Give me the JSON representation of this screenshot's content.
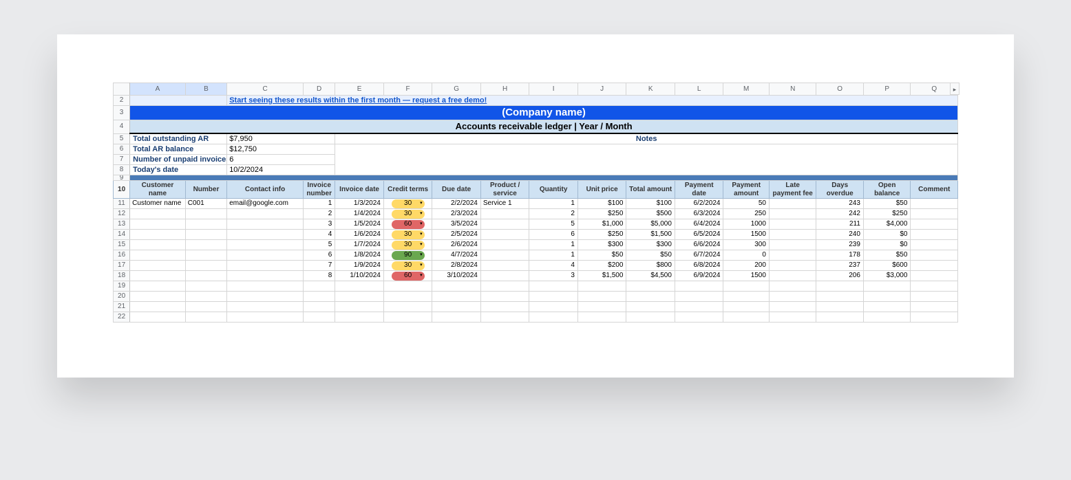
{
  "columns": [
    "A",
    "B",
    "C",
    "D",
    "E",
    "F",
    "G",
    "H",
    "I",
    "J",
    "K",
    "L",
    "M",
    "N",
    "O",
    "P",
    "Q"
  ],
  "selected_columns": [
    "A",
    "B"
  ],
  "row_numbers": [
    "2",
    "3",
    "4",
    "5",
    "6",
    "7",
    "8",
    "9",
    "10",
    "11",
    "12",
    "13",
    "14",
    "15",
    "16",
    "17",
    "18",
    "19",
    "20",
    "21",
    "22"
  ],
  "link_text": "Start seeing these results within the first month — request a free demo!",
  "company_name": "(Company name)",
  "ledger_title": "Accounts receivable ledger | Year / Month",
  "summary": {
    "total_outstanding_ar_label": "Total outstanding AR",
    "total_outstanding_ar_value": "$7,950",
    "total_ar_balance_label": "Total AR balance",
    "total_ar_balance_value": "$12,750",
    "unpaid_invoices_label": "Number of unpaid invoices",
    "unpaid_invoices_value": "6",
    "todays_date_label": "Today's date",
    "todays_date_value": "10/2/2024",
    "notes_label": "Notes"
  },
  "headers": {
    "customer_name": "Customer name",
    "number": "Number",
    "contact_info": "Contact info",
    "invoice_number": "Invoice number",
    "invoice_date": "Invoice date",
    "credit_terms": "Credit terms",
    "due_date": "Due date",
    "product_service": "Product / service",
    "quantity": "Quantity",
    "unit_price": "Unit price",
    "total_amount": "Total amount",
    "payment_date": "Payment date",
    "payment_amount": "Payment amount",
    "late_payment_fee": "Late payment fee",
    "days_overdue": "Days overdue",
    "open_balance": "Open balance",
    "comment": "Comment"
  },
  "rows": [
    {
      "customer_name": "Customer name",
      "number": "C001",
      "contact_info": "email@google.com",
      "invoice_number": "1",
      "invoice_date": "1/3/2024",
      "credit_terms": "30",
      "credit_terms_class": "ct-30",
      "due_date": "2/2/2024",
      "product_service": "Service 1",
      "quantity": "1",
      "unit_price": "$100",
      "total_amount": "$100",
      "payment_date": "6/2/2024",
      "payment_amount": "50",
      "late_payment_fee": "",
      "days_overdue": "243",
      "open_balance": "$50",
      "comment": ""
    },
    {
      "customer_name": "",
      "number": "",
      "contact_info": "",
      "invoice_number": "2",
      "invoice_date": "1/4/2024",
      "credit_terms": "30",
      "credit_terms_class": "ct-30",
      "due_date": "2/3/2024",
      "product_service": "",
      "quantity": "2",
      "unit_price": "$250",
      "total_amount": "$500",
      "payment_date": "6/3/2024",
      "payment_amount": "250",
      "late_payment_fee": "",
      "days_overdue": "242",
      "open_balance": "$250",
      "comment": ""
    },
    {
      "customer_name": "",
      "number": "",
      "contact_info": "",
      "invoice_number": "3",
      "invoice_date": "1/5/2024",
      "credit_terms": "60",
      "credit_terms_class": "ct-60",
      "due_date": "3/5/2024",
      "product_service": "",
      "quantity": "5",
      "unit_price": "$1,000",
      "total_amount": "$5,000",
      "payment_date": "6/4/2024",
      "payment_amount": "1000",
      "late_payment_fee": "",
      "days_overdue": "211",
      "open_balance": "$4,000",
      "comment": ""
    },
    {
      "customer_name": "",
      "number": "",
      "contact_info": "",
      "invoice_number": "4",
      "invoice_date": "1/6/2024",
      "credit_terms": "30",
      "credit_terms_class": "ct-30",
      "due_date": "2/5/2024",
      "product_service": "",
      "quantity": "6",
      "unit_price": "$250",
      "total_amount": "$1,500",
      "payment_date": "6/5/2024",
      "payment_amount": "1500",
      "late_payment_fee": "",
      "days_overdue": "240",
      "open_balance": "$0",
      "comment": ""
    },
    {
      "customer_name": "",
      "number": "",
      "contact_info": "",
      "invoice_number": "5",
      "invoice_date": "1/7/2024",
      "credit_terms": "30",
      "credit_terms_class": "ct-30",
      "due_date": "2/6/2024",
      "product_service": "",
      "quantity": "1",
      "unit_price": "$300",
      "total_amount": "$300",
      "payment_date": "6/6/2024",
      "payment_amount": "300",
      "late_payment_fee": "",
      "days_overdue": "239",
      "open_balance": "$0",
      "comment": ""
    },
    {
      "customer_name": "",
      "number": "",
      "contact_info": "",
      "invoice_number": "6",
      "invoice_date": "1/8/2024",
      "credit_terms": "90",
      "credit_terms_class": "ct-90",
      "due_date": "4/7/2024",
      "product_service": "",
      "quantity": "1",
      "unit_price": "$50",
      "total_amount": "$50",
      "payment_date": "6/7/2024",
      "payment_amount": "0",
      "late_payment_fee": "",
      "days_overdue": "178",
      "open_balance": "$50",
      "comment": ""
    },
    {
      "customer_name": "",
      "number": "",
      "contact_info": "",
      "invoice_number": "7",
      "invoice_date": "1/9/2024",
      "credit_terms": "30",
      "credit_terms_class": "ct-30",
      "due_date": "2/8/2024",
      "product_service": "",
      "quantity": "4",
      "unit_price": "$200",
      "total_amount": "$800",
      "payment_date": "6/8/2024",
      "payment_amount": "200",
      "late_payment_fee": "",
      "days_overdue": "237",
      "open_balance": "$600",
      "comment": ""
    },
    {
      "customer_name": "",
      "number": "",
      "contact_info": "",
      "invoice_number": "8",
      "invoice_date": "1/10/2024",
      "credit_terms": "60",
      "credit_terms_class": "ct-60",
      "due_date": "3/10/2024",
      "product_service": "",
      "quantity": "3",
      "unit_price": "$1,500",
      "total_amount": "$4,500",
      "payment_date": "6/9/2024",
      "payment_amount": "1500",
      "late_payment_fee": "",
      "days_overdue": "206",
      "open_balance": "$3,000",
      "comment": ""
    }
  ]
}
